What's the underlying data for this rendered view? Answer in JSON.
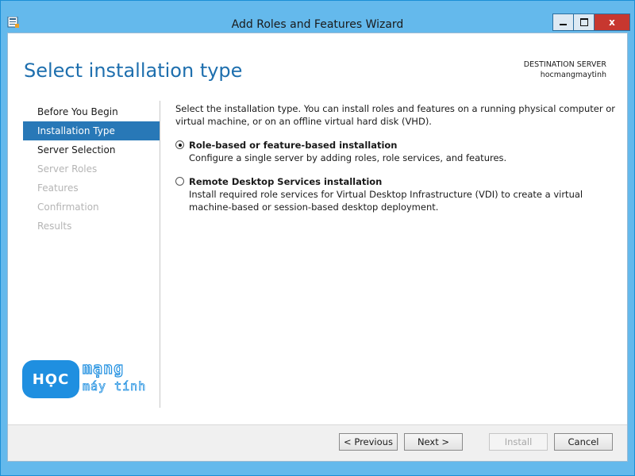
{
  "window": {
    "title": "Add Roles and Features Wizard",
    "controls": {
      "minimize": "—",
      "maximize": "□",
      "close": "x"
    }
  },
  "header": {
    "page_title": "Select installation type",
    "destination_label": "DESTINATION SERVER",
    "destination_value": "hocmangmaytinh"
  },
  "nav": {
    "items": [
      {
        "label": "Before You Begin",
        "state": "normal"
      },
      {
        "label": "Installation Type",
        "state": "active"
      },
      {
        "label": "Server Selection",
        "state": "normal"
      },
      {
        "label": "Server Roles",
        "state": "disabled"
      },
      {
        "label": "Features",
        "state": "disabled"
      },
      {
        "label": "Confirmation",
        "state": "disabled"
      },
      {
        "label": "Results",
        "state": "disabled"
      }
    ]
  },
  "logo": {
    "text_primary": "HỌC",
    "text_secondary": "mạng",
    "text_tertiary": "máy tính",
    "color": "#1f8fe0"
  },
  "content": {
    "intro": "Select the installation type. You can install roles and features on a running physical computer or virtual machine, or on an offline virtual hard disk (VHD).",
    "options": [
      {
        "label": "Role-based or feature-based installation",
        "description": "Configure a single server by adding roles, role services, and features.",
        "checked": true
      },
      {
        "label": "Remote Desktop Services installation",
        "description": "Install required role services for Virtual Desktop Infrastructure (VDI) to create a virtual machine-based or session-based desktop deployment.",
        "checked": false
      }
    ]
  },
  "footer": {
    "previous": "< Previous",
    "next": "Next >",
    "install": "Install",
    "cancel": "Cancel"
  },
  "colors": {
    "title_bar": "#64b9ec",
    "accent": "#2878b7",
    "page_title": "#1e6fae",
    "close_button": "#c7372f"
  }
}
